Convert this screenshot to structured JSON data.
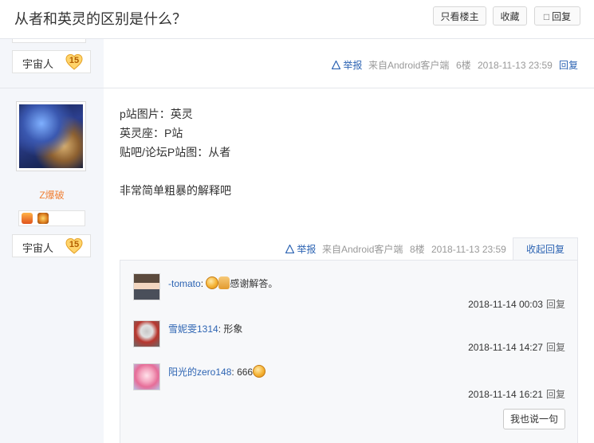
{
  "header": {
    "title": "从者和英灵的区别是什么？",
    "buttons": {
      "only_author": "只看楼主",
      "favorite": "收藏",
      "reply": "回复"
    },
    "reply_icon": "speech-bubble-icon"
  },
  "post_top": {
    "author_rank": {
      "name": "宇宙人",
      "level": "15"
    },
    "tail": {
      "report": "举报",
      "source": "来自Android客户端",
      "floor": "6楼",
      "time": "2018-11-13 23:59",
      "reply": "回复"
    }
  },
  "post_main": {
    "author": {
      "name": "Z爆破",
      "rank": "宇宙人",
      "level": "15"
    },
    "content": [
      "p站图片：英灵",
      "英灵座：P站",
      "贴吧/论坛P站图：从者",
      "",
      "非常简单粗暴的解释吧"
    ],
    "tail": {
      "report": "举报",
      "source": "来自Android客户端",
      "floor": "8楼",
      "time": "2018-11-13 23:59",
      "fold": "收起回复"
    },
    "replies": [
      {
        "user": "-tomato",
        "sep": ":",
        "text": "感谢解答。",
        "time": "2018-11-14 00:03",
        "reply": "回复"
      },
      {
        "user": "雪妮雯1314",
        "sep": ":",
        "text": "形象",
        "time": "2018-11-14 14:27",
        "reply": "回复"
      },
      {
        "user": "阳光的zero148",
        "sep": ":",
        "text": "666",
        "time": "2018-11-14 16:21",
        "reply": "回复"
      }
    ],
    "say_button": "我也说一句"
  },
  "colors": {
    "link": "#2d64b3",
    "username": "#f08137",
    "sidebar": "#f4f6fa"
  }
}
